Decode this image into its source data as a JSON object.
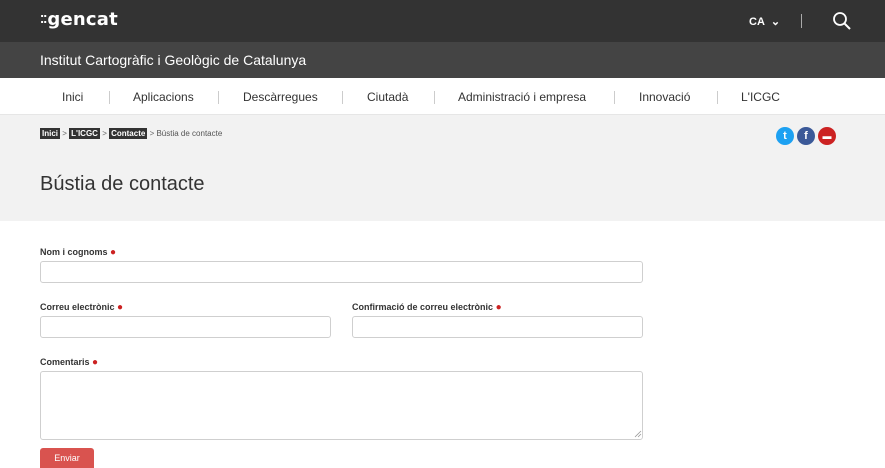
{
  "topbar": {
    "logo_dots": "⁚⁚",
    "logo_text": "gencat",
    "lang_label": "CA",
    "lang_chevron": "⌄",
    "divider": "|",
    "search_icon": "search-icon"
  },
  "org": {
    "title": "Institut Cartogràfic i Geològic de Catalunya"
  },
  "nav": {
    "items": [
      {
        "label": "Inici"
      },
      {
        "label": "Aplicacions"
      },
      {
        "label": "Descàrregues"
      },
      {
        "label": "Ciutadà"
      },
      {
        "label": "Administració i empresa"
      },
      {
        "label": "Innovació"
      },
      {
        "label": "L'ICGC"
      }
    ]
  },
  "breadcrumb": {
    "items": [
      {
        "label": "Inici"
      },
      {
        "label": "L'ICGC"
      },
      {
        "label": "Contacte"
      },
      {
        "label": "Bústia de contacte"
      }
    ],
    "separator": ">"
  },
  "social": {
    "twitter": {
      "icon": "twitter-icon",
      "glyph": "t",
      "color": "#1da1f2"
    },
    "facebook": {
      "icon": "facebook-icon",
      "glyph": "f",
      "color": "#3b5998"
    },
    "print": {
      "icon": "print-icon",
      "glyph": "▬",
      "color": "#cc2222"
    }
  },
  "page": {
    "title": "Bústia de contacte"
  },
  "form": {
    "name_label": "Nom i cognoms",
    "email_label": "Correu electrònic",
    "email_confirm_label": "Confirmació de correu electrònic",
    "comments_label": "Comentaris",
    "required_mark": "●",
    "submit_label": "Enviar"
  },
  "colors": {
    "topbar": "#333333",
    "orgbar": "#444444",
    "header_bg": "#f2f2f2",
    "required": "#cc2222",
    "button": "#d9534f"
  }
}
